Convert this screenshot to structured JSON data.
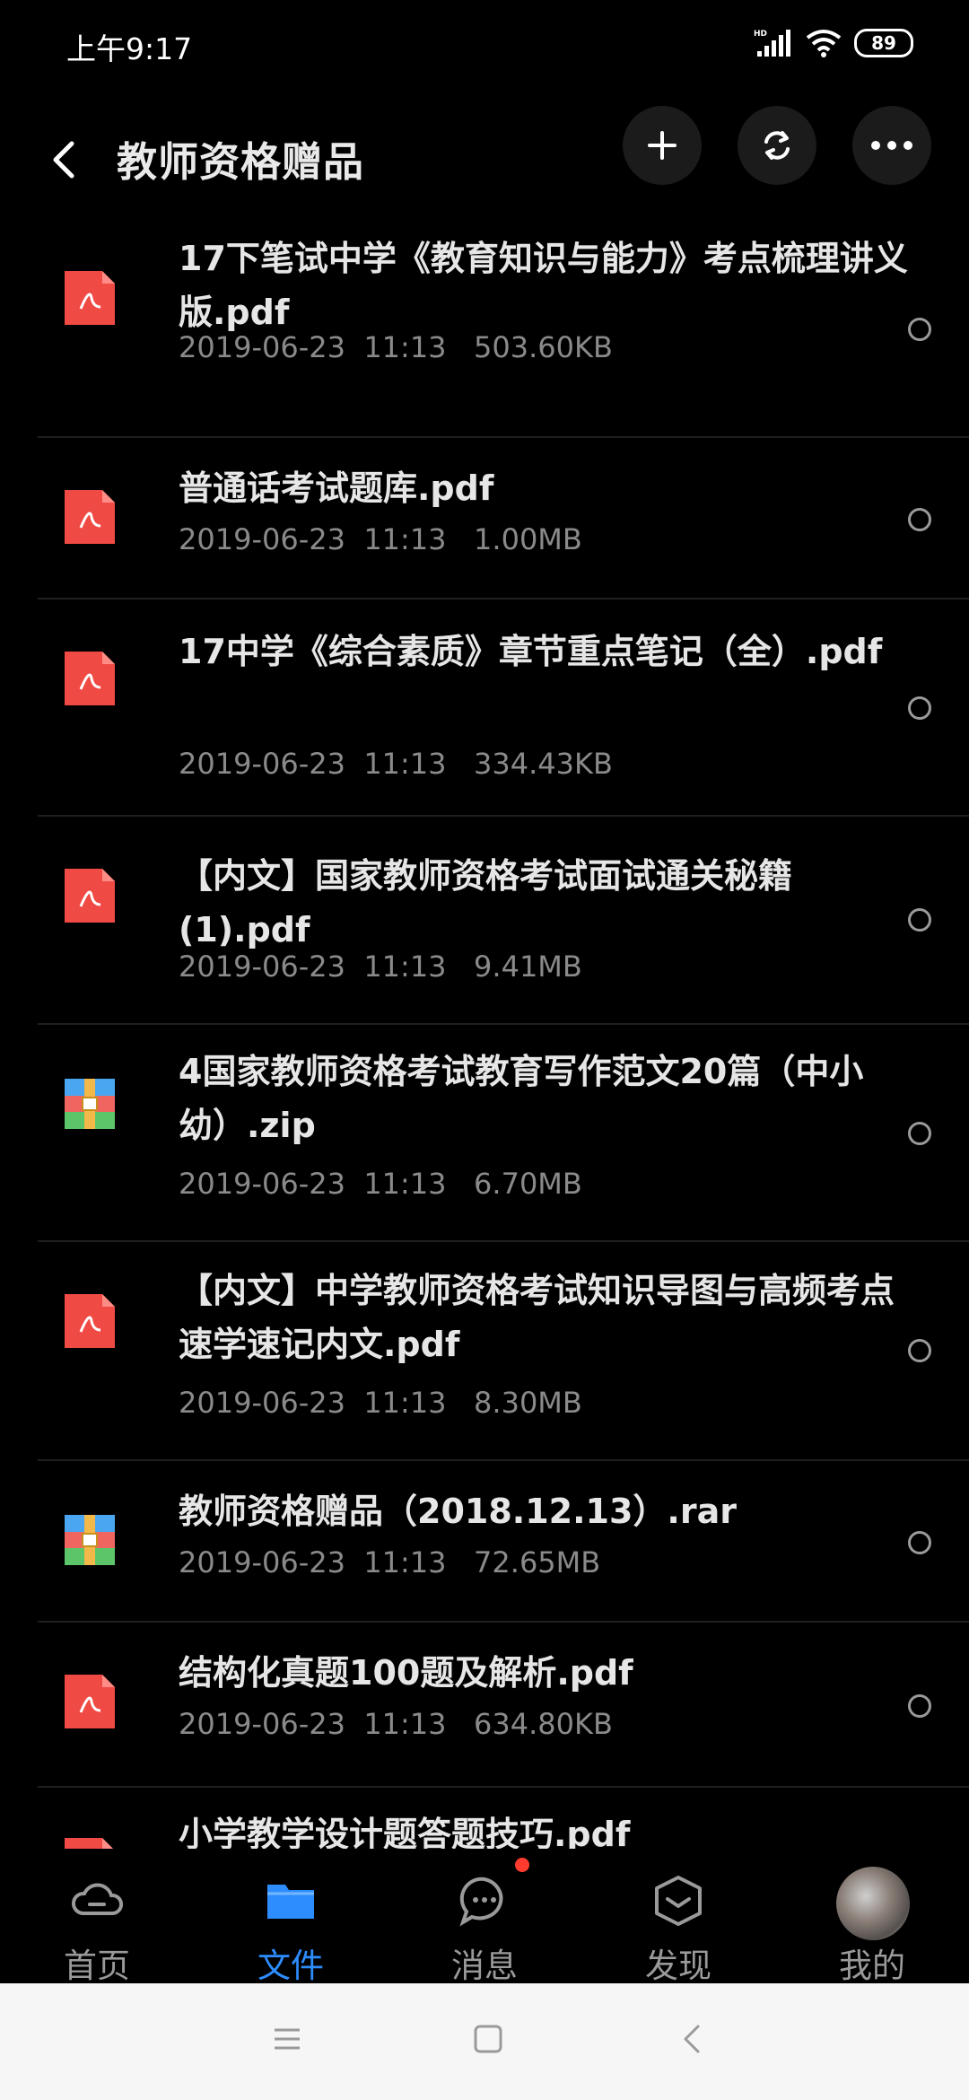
{
  "status": {
    "time": "上午9:17",
    "battery": "89",
    "network": "HD"
  },
  "header": {
    "title": "教师资格赠品"
  },
  "files": [
    {
      "name": "17下笔试中学《教育知识与能力》考点梳理讲义版.pdf",
      "date": "2019-06-23  11:13",
      "size": "503.60KB",
      "type": "pdf"
    },
    {
      "name": "普通话考试题库.pdf",
      "date": "2019-06-23  11:13",
      "size": "1.00MB",
      "type": "pdf"
    },
    {
      "name": "17中学《综合素质》章节重点笔记（全）.pdf",
      "date": "2019-06-23  11:13",
      "size": "334.43KB",
      "type": "pdf"
    },
    {
      "name": "【内文】国家教师资格考试面试通关秘籍(1).pdf",
      "date": "2019-06-23  11:13",
      "size": "9.41MB",
      "type": "pdf"
    },
    {
      "name": "4国家教师资格考试教育写作范文20篇（中小幼）.zip",
      "date": "2019-06-23  11:13",
      "size": "6.70MB",
      "type": "archive"
    },
    {
      "name": "【内文】中学教师资格考试知识导图与高频考点速学速记内文.pdf",
      "date": "2019-06-23  11:13",
      "size": "8.30MB",
      "type": "pdf"
    },
    {
      "name": "教师资格赠品（2018.12.13）.rar",
      "date": "2019-06-23  11:13",
      "size": "72.65MB",
      "type": "archive"
    },
    {
      "name": "结构化真题100题及解析.pdf",
      "date": "2019-06-23  11:13",
      "size": "634.80KB",
      "type": "pdf"
    },
    {
      "name": "小学教学设计题答题技巧.pdf",
      "date": "",
      "size": "",
      "type": "pdf"
    }
  ],
  "nav": {
    "items": [
      {
        "label": "首页",
        "icon": "cloud-icon"
      },
      {
        "label": "文件",
        "icon": "folder-icon"
      },
      {
        "label": "消息",
        "icon": "chat-icon"
      },
      {
        "label": "发现",
        "icon": "discover-icon"
      },
      {
        "label": "我的",
        "icon": "avatar"
      }
    ],
    "active": "文件"
  },
  "colors": {
    "accent": "#2d8dff",
    "pdf": "#f04a44",
    "badge": "#ff3b30"
  }
}
